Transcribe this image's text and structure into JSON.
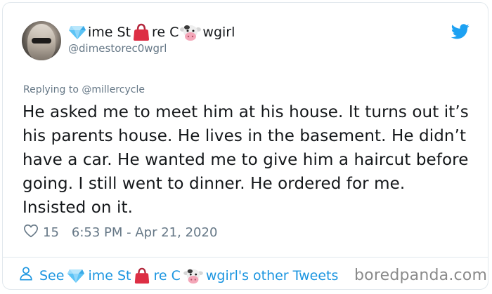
{
  "tweet": {
    "name_parts": [
      "ime St",
      "re C",
      "wgirl"
    ],
    "name_emojis": [
      "diamond-emoji",
      "handbag-emoji",
      "cow-face-emoji"
    ],
    "handle": "@dimestorec0wgrl",
    "replying_prefix": "Replying to",
    "replying_to": "@millercycle",
    "text": "He asked me to meet him at his house. It turns out it’s his parents house. He lives in the basement. He didn’t have a car. He wanted me to give him a haircut before going. I still went to dinner. He ordered for me. Insisted on it.",
    "likes": "15",
    "timestamp": "6:53 PM - Apr 21, 2020"
  },
  "footer": {
    "see_prefix": "See",
    "name_parts": [
      "ime St",
      "re C",
      "wgirl's other Tweets"
    ]
  },
  "watermark": "boredpanda.com",
  "colors": {
    "text": "#14171a",
    "muted": "#657786",
    "link": "#1b95e0",
    "border": "#e1e8ed",
    "twitter_blue": "#1da1f2"
  },
  "icons": [
    "twitter-bird-icon",
    "heart-icon",
    "person-icon"
  ]
}
